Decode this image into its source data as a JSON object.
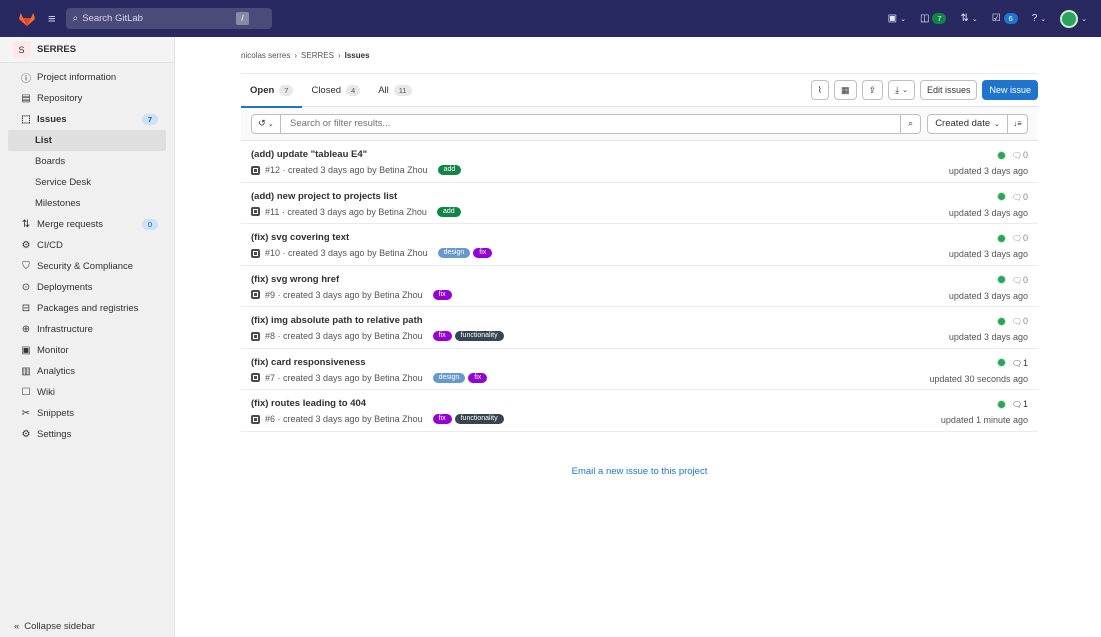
{
  "topbar": {
    "search_placeholder": "Search GitLab",
    "slash": "/",
    "issues_count": "7",
    "todos_count": "6"
  },
  "sidebar": {
    "project_initial": "S",
    "project_name": "SERRES",
    "items": [
      {
        "icon": "ⓘ",
        "label": "Project information"
      },
      {
        "icon": "▤",
        "label": "Repository"
      },
      {
        "icon": "⬚",
        "label": "Issues",
        "badge": "7"
      },
      {
        "icon": "⇅",
        "label": "Merge requests",
        "badge": "0"
      },
      {
        "icon": "⚙",
        "label": "CI/CD"
      },
      {
        "icon": "⛉",
        "label": "Security & Compliance"
      },
      {
        "icon": "⊙",
        "label": "Deployments"
      },
      {
        "icon": "⊟",
        "label": "Packages and registries"
      },
      {
        "icon": "⊕",
        "label": "Infrastructure"
      },
      {
        "icon": "▣",
        "label": "Monitor"
      },
      {
        "icon": "▥",
        "label": "Analytics"
      },
      {
        "icon": "☐",
        "label": "Wiki"
      },
      {
        "icon": "✂",
        "label": "Snippets"
      },
      {
        "icon": "⚙",
        "label": "Settings"
      }
    ],
    "issues_sub": [
      "List",
      "Boards",
      "Service Desk",
      "Milestones"
    ],
    "collapse": "Collapse sidebar"
  },
  "breadcrumb": {
    "user": "nicolas serres",
    "project": "SERRES",
    "current": "Issues",
    "sep": "›"
  },
  "tabs": [
    {
      "label": "Open",
      "count": "7"
    },
    {
      "label": "Closed",
      "count": "4"
    },
    {
      "label": "All",
      "count": "11"
    }
  ],
  "actions": {
    "edit": "Edit issues",
    "new": "New issue"
  },
  "filter": {
    "placeholder": "Search or filter results...",
    "sort": "Created date"
  },
  "label_colors": {
    "add": "#108548",
    "design": "#6699cc",
    "fix": "#9400d3",
    "functionality": "#36454f"
  },
  "issues": [
    {
      "title": "(add) update \"tableau E4\"",
      "meta": "#12 · created 3 days ago by Betina Zhou",
      "labels": [
        "add"
      ],
      "comments": "0",
      "updated": "updated 3 days ago"
    },
    {
      "title": "(add) new project to projects list",
      "meta": "#11 · created 3 days ago by Betina Zhou",
      "labels": [
        "add"
      ],
      "comments": "0",
      "updated": "updated 3 days ago"
    },
    {
      "title": "(fix) svg covering text",
      "meta": "#10 · created 3 days ago by Betina Zhou",
      "labels": [
        "design",
        "fix"
      ],
      "comments": "0",
      "updated": "updated 3 days ago"
    },
    {
      "title": "(fix) svg wrong href",
      "meta": "#9 · created 3 days ago by Betina Zhou",
      "labels": [
        "fix"
      ],
      "comments": "0",
      "updated": "updated 3 days ago"
    },
    {
      "title": "(fix) img absolute path to relative path",
      "meta": "#8 · created 3 days ago by Betina Zhou",
      "labels": [
        "fix",
        "functionality"
      ],
      "comments": "0",
      "updated": "updated 3 days ago"
    },
    {
      "title": "(fix) card responsiveness",
      "meta": "#7 · created 3 days ago by Betina Zhou",
      "labels": [
        "design",
        "fix"
      ],
      "comments": "1",
      "updated": "updated 30 seconds ago"
    },
    {
      "title": "(fix) routes leading to 404",
      "meta": "#6 · created 3 days ago by Betina Zhou",
      "labels": [
        "fix",
        "functionality"
      ],
      "comments": "1",
      "updated": "updated 1 minute ago"
    }
  ],
  "email_link": "Email a new issue to this project"
}
